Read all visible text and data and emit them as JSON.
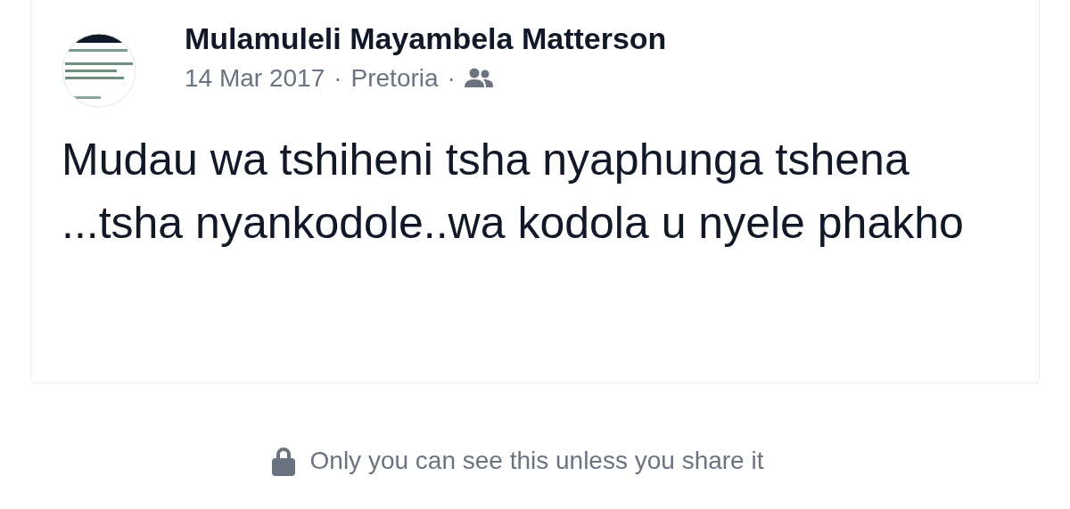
{
  "post": {
    "author": "Mulamuleli Mayambela Matterson",
    "date": "14 Mar 2017",
    "location": "Pretoria",
    "separator": "·",
    "body": "Mudau wa tshiheni tsha nyaphunga tshena ...tsha nyankodole..wa kodola u nyele phakho"
  },
  "privacy_note": "Only you can see this unless you share it"
}
